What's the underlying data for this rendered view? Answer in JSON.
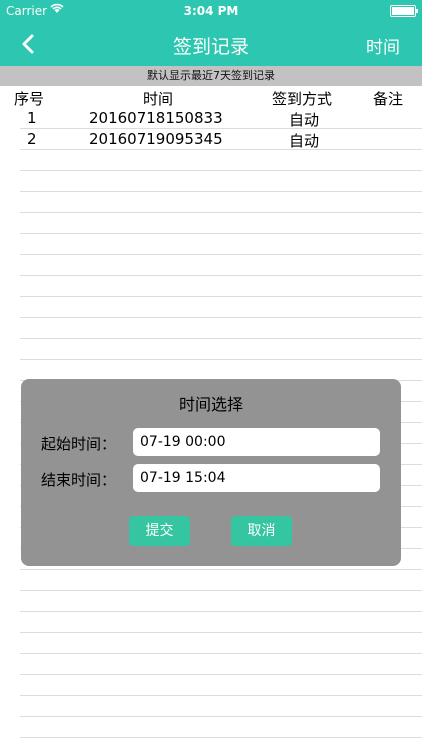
{
  "status": {
    "carrier": "Carrier",
    "time": "3:04 PM"
  },
  "nav": {
    "title": "签到记录",
    "right_label": "时间"
  },
  "banner": "默认显示最近7天签到记录",
  "table": {
    "headers": [
      "序号",
      "时间",
      "签到方式",
      "备注"
    ],
    "rows": [
      [
        "1",
        "20160718150833",
        "自动",
        ""
      ],
      [
        "2",
        "20160719095345",
        "自动",
        ""
      ]
    ]
  },
  "dialog": {
    "title": "时间选择",
    "start_label": "起始时间：",
    "start_value": "07-19 00:00",
    "end_label": "结束时间：",
    "end_value": "07-19 15:04",
    "submit_label": "提交",
    "cancel_label": "取消"
  },
  "colors": {
    "accent": "#2dc7b1",
    "button": "#35c5a0",
    "dialog_bg": "#939393",
    "banner_bg": "#c2c2c2"
  },
  "icons": [
    "wifi-icon",
    "battery-icon",
    "back-chevron-icon"
  ]
}
